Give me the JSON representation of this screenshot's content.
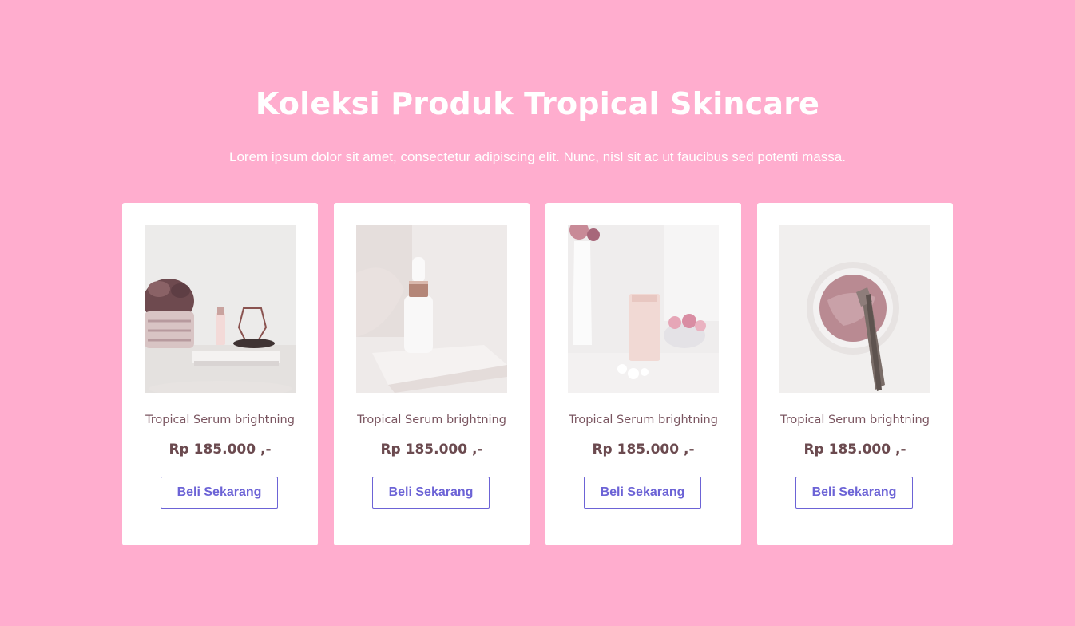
{
  "section": {
    "title": "Koleksi Produk Tropical Skincare",
    "subtitle": "Lorem ipsum dolor sit amet, consectetur adipiscing elit. Nunc, nisl sit ac ut faucibus sed potenti massa."
  },
  "products": [
    {
      "name": "Tropical Serum brightning",
      "price": "Rp 185.000 ,-",
      "button": "Beli Sekarang",
      "image": "serum-bottle-with-plant-photo"
    },
    {
      "name": "Tropical Serum brightning",
      "price": "Rp 185.000 ,-",
      "button": "Beli Sekarang",
      "image": "dropper-bottle-photo"
    },
    {
      "name": "Tropical Serum brightning",
      "price": "Rp 185.000 ,-",
      "button": "Beli Sekarang",
      "image": "cream-tube-with-flowers-photo"
    },
    {
      "name": "Tropical Serum brightning",
      "price": "Rp 185.000 ,-",
      "button": "Beli Sekarang",
      "image": "face-mask-jar-with-brush-photo"
    }
  ],
  "colors": {
    "background": "#FFADCE",
    "card": "#FFFFFF",
    "button_accent": "#6C63D6",
    "price_text": "#6B4A4F"
  }
}
